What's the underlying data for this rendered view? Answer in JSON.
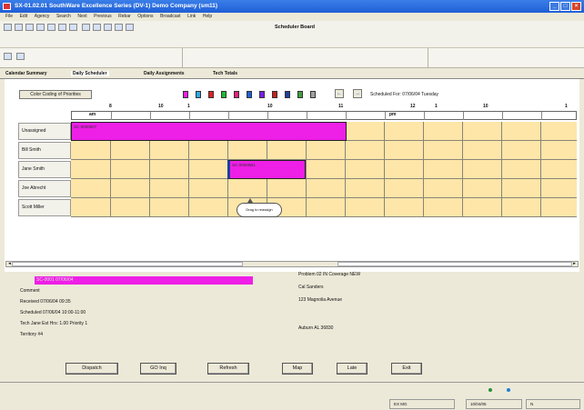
{
  "window": {
    "title": "SX-01.02.01  SouthWare Excellence Series (DV-1)  Demo Company (sm11)",
    "buttons": [
      "_",
      "□",
      "×"
    ]
  },
  "menu": [
    "File",
    "Edit",
    "Agency",
    "Search",
    "Next",
    "Previous",
    "Rebar",
    "Options",
    "Broadcast",
    "Link",
    "Help"
  ],
  "toolbar": {
    "board_title": "Scheduler Board"
  },
  "tabs": [
    "Calendar Summary",
    "Daily Scheduler",
    "Daily Assignments",
    "Tech Totals"
  ],
  "scheduler": {
    "color_coding_label": "Color Coding of Priorities",
    "swatch_colors": [
      "#ee1fe6",
      "#2fa8e8",
      "#e81f1f",
      "#1fbb2f",
      "#e81f7a",
      "#2060d8",
      "#7a1fe8",
      "#c81f1f",
      "#1f3fa0",
      "#3fa040",
      "#a0a0a0"
    ],
    "nav": [
      "←",
      "→"
    ],
    "scheduled_for": "Scheduled For: 07/06/04 Tuesday",
    "hours": [
      "8",
      "10",
      "1",
      "10",
      "11",
      "12",
      "1",
      "10",
      "1"
    ],
    "ampm": [
      "am",
      "pm"
    ],
    "rows": [
      "Unassigned",
      "Bill Smith",
      "Jane Smith",
      "Joe Abrecht",
      "Scott Miller"
    ],
    "jobs": [
      {
        "row": 0,
        "label": "SC-0000007"
      },
      {
        "row": 2,
        "label": "SC-00000B1"
      }
    ],
    "callout": "Drag to reassign"
  },
  "details": {
    "selected_job": "SC-0001 07/06/04",
    "comment": "Comment",
    "received": "Received 07/06/04 09:35",
    "scheduled": "Scheduled 07/06/04 10:00-11:00",
    "tech": "Tech Jane  Est Hrs: 1.00 Priority 1",
    "territory": "Territory #4",
    "problem": "Problem 02 IN Coverage NEW",
    "customer": "Cal Sanders",
    "address": "123 Magnolia Avenue",
    "city": "Auburn AL 36830"
  },
  "buttons": [
    "Dispatch",
    "GO Inq",
    "Refresh",
    "Map",
    "Late",
    "Exit"
  ],
  "status": {
    "dots": [
      "#2a8f3a",
      "#1f7fd8"
    ],
    "panels": [
      "EX MG",
      "10/04/05",
      "N"
    ]
  }
}
